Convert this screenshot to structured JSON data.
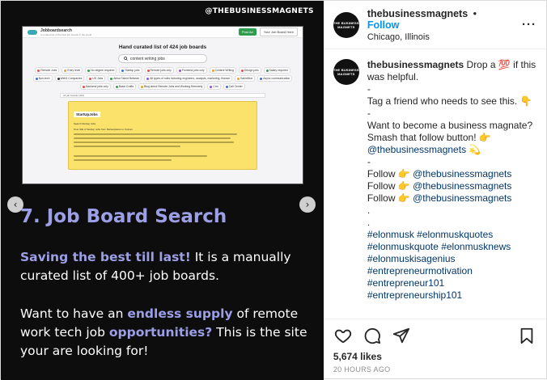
{
  "post": {
    "media": {
      "handle_overlay": "@THEBUSINESSMAGNETS",
      "screenshot": {
        "logo_text": "Jobboardsearch",
        "tagline": "A curated list of the best job boards in the world",
        "post_job_label": "Post Ad",
        "submit_label": "Your Job Board Here",
        "heading": "Hand curated list of 424 job boards",
        "search_value": "content writing jobs",
        "chips": [
          {
            "label": "Remote Jobs",
            "color": "#e05050"
          },
          {
            "label": "Entry level",
            "color": "#f0a030"
          },
          {
            "label": "No degree required",
            "color": "#2e9e4e"
          },
          {
            "label": "Startup jobs",
            "color": "#3a6ee8"
          },
          {
            "label": "Remote jobs only",
            "color": "#e05050"
          },
          {
            "label": "Frontend jobs only",
            "color": "#9a4be0"
          },
          {
            "label": "Content Writing",
            "color": "#f0a030"
          },
          {
            "label": "Design jobs",
            "color": "#e05050"
          },
          {
            "label": "Salary required",
            "color": "#2e9e4e"
          },
          {
            "label": "Non-tech",
            "color": "#3a6ee8"
          },
          {
            "label": "Web3 Companies",
            "color": "#333333"
          },
          {
            "label": "US Jobs",
            "color": "#e05050"
          },
          {
            "label": "Africa Talent Network",
            "color": "#2e9e4e"
          },
          {
            "label": "All types of roles including engineers, analysts, marketing, finance",
            "color": "#9a4be0"
          },
          {
            "label": "SalesBlox",
            "color": "#f0a030"
          },
          {
            "label": "Async communication",
            "color": "#3a6ee8"
          },
          {
            "label": "Backend jobs only",
            "color": "#e05050"
          },
          {
            "label": "Basic Crafts",
            "color": "#2e9e4e"
          },
          {
            "label": "Blog about Remote Jobs and Working Remotely",
            "color": "#f0a030"
          },
          {
            "label": "Crm",
            "color": "#9a4be0"
          },
          {
            "label": "Call Center",
            "color": "#3a6ee8"
          }
        ],
        "filter_bar_text": "All job boards (424)",
        "card_title": "StartUpJobs",
        "card_subtitle": "Search Startup Jobs",
        "card_line": "Over 60k of Startup Jobs from Marketplaces to Unicorn"
      },
      "slide_heading": "7. Job Board Search",
      "para1_highlight": "Saving the best till last!",
      "para1_rest": " It is a manually curated list of 400+ job boards.",
      "para2_part1": "Want to have an ",
      "para2_highlight1": "endless supply",
      "para2_part2": " of remote work tech job ",
      "para2_highlight2": "opportunities?",
      "para2_part3": " This is the site your are looking for!"
    },
    "header": {
      "username": "thebusinessmagnets",
      "dot": "•",
      "follow_label": "Follow",
      "location": "Chicago, Illinois",
      "avatar_text": "THE BUSINESS MAGNETS",
      "more_label": "···"
    },
    "caption": {
      "username": "thebusinessmagnets",
      "line1_text": " Drop a ",
      "line1_emoji": "💯",
      "line1_end": " if this was helpful.",
      "dash": "-",
      "tag_text": "Tag a friend who needs to see this. ",
      "tag_emoji": "👇",
      "want_text": "Want to become a business magnate? Smash that follow button! ",
      "want_emoji": "👉",
      "want_mention": "@thebusinessmagnets",
      "want_emoji2": "💫",
      "follow_word": "Follow ",
      "follow_emoji": "👉",
      "follow_mention": "@thebusinessmagnets",
      "dot_line": ".",
      "hashtags": [
        "#elonmusk #elonmuskquotes",
        "#elonmuskquote #elonmusknews",
        "#elonmuskisagenius",
        "#entrepreneurmotivation",
        "#entrepreneur101",
        "#entrepreneurship101"
      ]
    },
    "likes": "5,674 likes",
    "time": "20 HOURS AGO"
  }
}
